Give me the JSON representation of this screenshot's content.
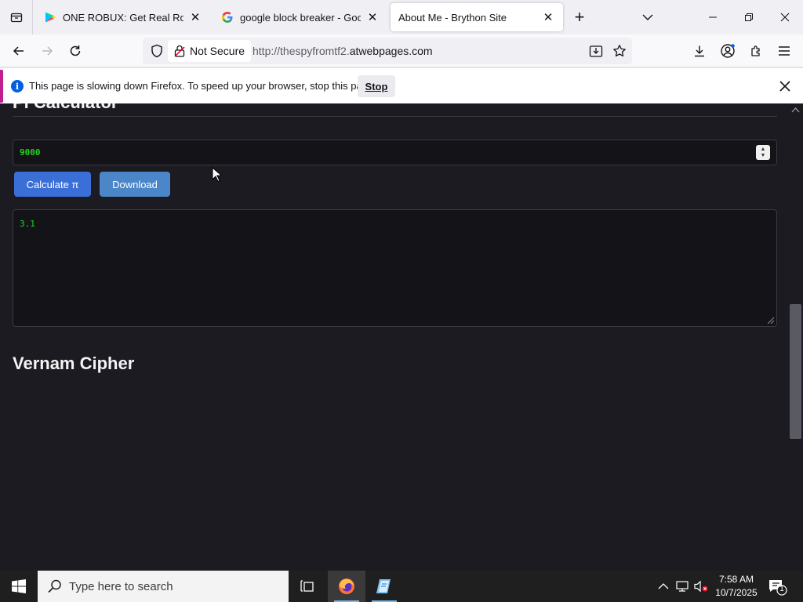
{
  "browser": {
    "tabs": [
      {
        "title": "ONE ROBUX: Get Real Robux - /",
        "favicon": "play-store-icon",
        "active": false
      },
      {
        "title": "google block breaker - Google",
        "favicon": "google-icon",
        "active": false
      },
      {
        "title": "About Me - Brython Site",
        "favicon": "none",
        "active": true
      }
    ],
    "new_tab": "+",
    "url": {
      "security_label": "Not Secure",
      "prefix": "http://thespyfromtf2.",
      "domain": "atwebpages.com"
    }
  },
  "notification": {
    "message": "This page is slowing down Firefox. To speed up your browser, stop this page.",
    "stop_label": "Stop"
  },
  "page": {
    "section_title": "Pi Calculator",
    "iterations_value": "9000",
    "calculate_label": "Calculate π",
    "download_label": "Download",
    "output_value": "3.1",
    "next_heading": "Vernam Cipher"
  },
  "taskbar": {
    "search_placeholder": "Type here to search",
    "time": "7:58 AM",
    "date": "10/7/2025",
    "notification_count": "1"
  },
  "colors": {
    "page_bg": "#1c1b22",
    "output_text": "#22d422",
    "calc_button": "#3b6fd8",
    "download_button": "#4a86c8",
    "firefox_blue": "#0060df"
  }
}
